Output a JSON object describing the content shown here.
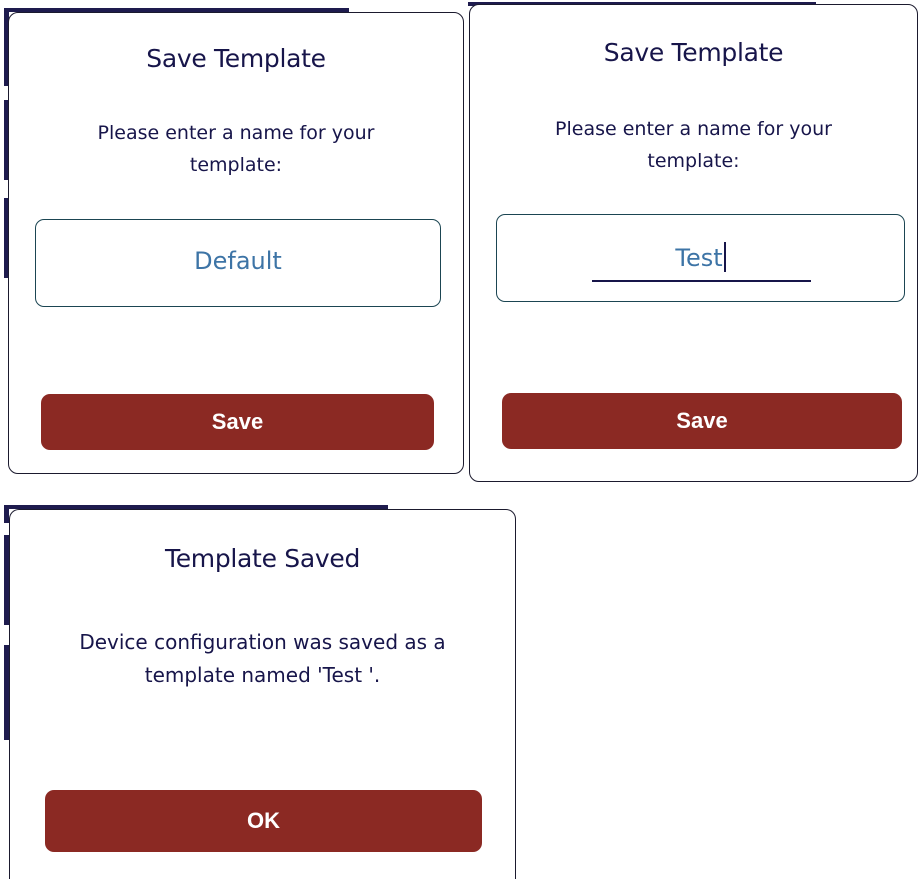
{
  "save_dialog_default": {
    "title": "Save Template",
    "message": "Please enter a name for your\ntemplate:",
    "field_value": "Default",
    "button_label": "Save"
  },
  "save_dialog_typing": {
    "title": "Save Template",
    "message": "Please enter a name for your\ntemplate:",
    "field_value": "Test",
    "button_label": "Save"
  },
  "saved_dialog": {
    "title": "Template Saved",
    "message": "Device configuration was saved as a\ntemplate named 'Test '.",
    "button_label": "OK"
  },
  "colors": {
    "title_text": "#17154a",
    "field_text": "#3d74a6",
    "button_bg": "#8b2923",
    "button_text": "#ffffff",
    "backdrop_bar": "#1e1b4e"
  }
}
